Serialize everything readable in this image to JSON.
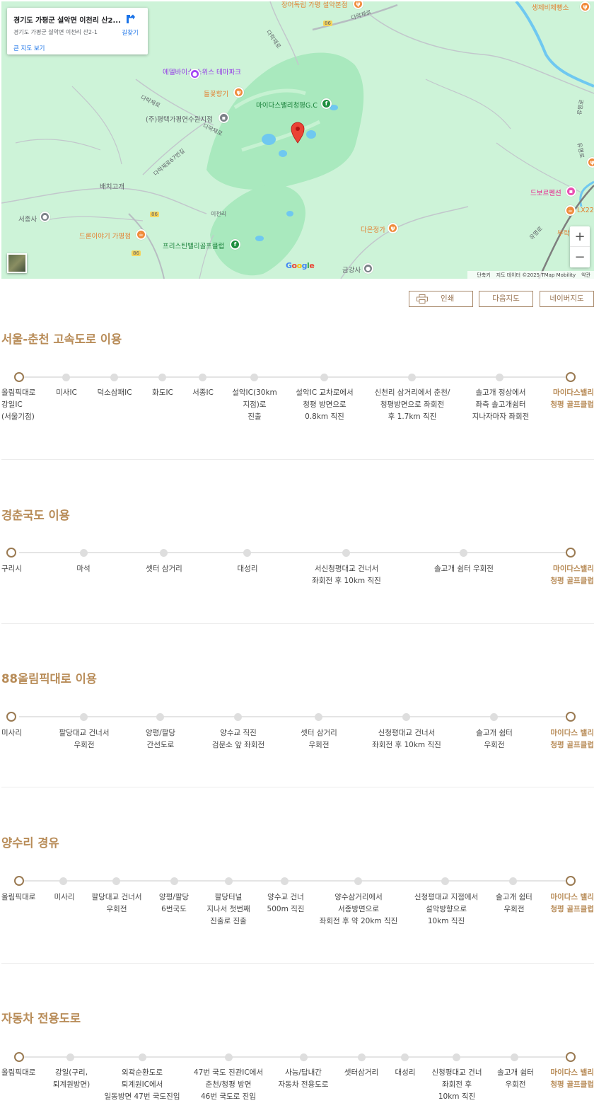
{
  "map": {
    "info_card": {
      "title": "경기도 가평군 설악면 이천리 산2...",
      "address": "경기도 가평군 설악면 이천리 산2-1",
      "directions_label": "길찾기",
      "larger_map_label": "큰 지도 보기"
    },
    "labels": [
      {
        "text": "장어독립 가평 설악본점",
        "color": "orange"
      },
      {
        "text": "생제비체빵소",
        "color": "orange"
      },
      {
        "text": "에델바이스 스위스 테마파크",
        "color": "purple"
      },
      {
        "text": "들꽃향기",
        "color": "orange"
      },
      {
        "text": "마이다스밸리청평G.C",
        "color": "green"
      },
      {
        "text": "(주)평택가평연수원지점",
        "color": "gray"
      },
      {
        "text": "배치고개",
        "color": "gray"
      },
      {
        "text": "서종사",
        "color": "gray"
      },
      {
        "text": "드론이야기 가평점",
        "color": "orange"
      },
      {
        "text": "이천리",
        "color": "gray"
      },
      {
        "text": "프리스틴밸리골프클럽",
        "color": "green"
      },
      {
        "text": "다온정가",
        "color": "orange"
      },
      {
        "text": "금강사",
        "color": "gray"
      },
      {
        "text": "드보르펜션",
        "color": "pink"
      },
      {
        "text": "LX22",
        "color": "orange"
      },
      {
        "text": "부락",
        "color": "orange"
      },
      {
        "text": "다락재로",
        "color": "gray"
      },
      {
        "text": "다락재로",
        "color": "gray"
      },
      {
        "text": "다락재로",
        "color": "gray"
      },
      {
        "text": "다락재로",
        "color": "gray"
      },
      {
        "text": "다락재로67번길",
        "color": "gray"
      },
      {
        "text": "유명로",
        "color": "gray"
      },
      {
        "text": "유명로",
        "color": "gray"
      },
      {
        "text": "유명로",
        "color": "gray"
      },
      {
        "text": "86",
        "color": "gray"
      },
      {
        "text": "86",
        "color": "gray"
      },
      {
        "text": "86",
        "color": "gray"
      }
    ],
    "google_logo": "Google",
    "attribution": {
      "shortcuts": "단축키",
      "data": "지도 데이터 ©2025 TMap Mobility",
      "terms": "약관"
    },
    "zoom_in": "+",
    "zoom_out": "−"
  },
  "buttons": {
    "print": "인쇄",
    "daum": "다음지도",
    "naver": "네이버지도"
  },
  "routes": [
    {
      "title": "서울-춘천 고속도로 이용",
      "stops": [
        "올림픽대로\n강일IC\n(서울기점)",
        "미사IC",
        "덕소삼패IC",
        "화도IC",
        "서종IC",
        "설악IC(30km\n지점)로\n진출",
        "설악IC 교차로에서\n청평 방면으로\n0.8km 직진",
        "신천리 삼거리에서 춘천/\n청평방면으로 좌회전\n후 1.7km 직진",
        "솔고개 정상에서\n좌측 솔고개쉼터\n지나자마자 좌회전",
        "마이다스밸리\n청평 골프클럽"
      ]
    },
    {
      "title": "경춘국도 이용",
      "stops": [
        "구리시",
        "마석",
        "셋터 삼거리",
        "대성리",
        "서신청평대교 건너서\n좌회전 후 10km 직진",
        "솔고개 쉼터 우회전",
        "마이다스밸리\n청평 골프클럽"
      ]
    },
    {
      "title": "88올림픽대로 이용",
      "stops": [
        "미사리",
        "팔당대교 건너서\n우회전",
        "양평/팔당\n간선도로",
        "양수교 직진\n검문소 앞 좌회전",
        "셋터 삼거리\n우회전",
        "신청평대교 건너서\n좌회전 후 10km 직진",
        "솔고개 쉼터\n우회전",
        "마이다스 밸리\n청평 골프클럽"
      ]
    },
    {
      "title": "양수리 경유",
      "stops": [
        "올림픽대로",
        "미사리",
        "팔당대교 건너서\n우회전",
        "양평/팔당\n6번국도",
        "팔당터널\n지나서 첫번째\n진출로 진출",
        "양수교 건너\n500m 직진",
        "양수삼거리에서\n서종방면으로\n좌회전 후 약 20km 직진",
        "신청평대교 지점에서\n설악방향으로\n10km 직진",
        "솔고개 쉼터\n우회전",
        "마이다스 밸리\n청평 골프클럽"
      ]
    },
    {
      "title": "자동차 전용도로",
      "stops": [
        "올림픽대로",
        "강일(구리,\n퇴계원방면)",
        "외곽순환도로\n퇴계원IC에서\n일동방면 47번 국도진입",
        "47번 국도 진관IC에서\n춘천/청평 방면\n46번 국도로 진입",
        "사능/답내간\n자동차 전용도로",
        "셋터삼거리",
        "대성리",
        "신청평대교 건너\n좌회전 후\n10km 직진",
        "솔고개 쉼터\n우회전",
        "마이다스 밸리\n청평 골프클럽"
      ]
    }
  ],
  "colors": {
    "accent": "#b88c58",
    "endpoint": "#9a7a52",
    "map_bg": "#cdf3d8",
    "park": "#a8e8bd",
    "water": "#6fc8f0",
    "marker": "#ea4335"
  }
}
